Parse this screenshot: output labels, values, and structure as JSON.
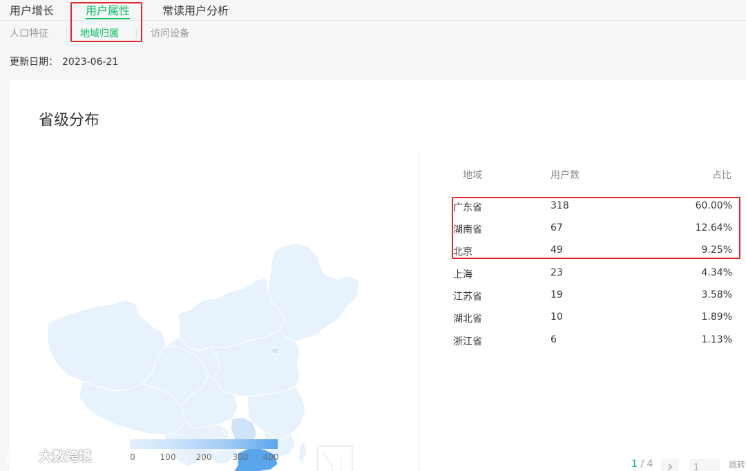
{
  "tabs": [
    {
      "label": "用户增长",
      "active": false
    },
    {
      "label": "用户属性",
      "active": true
    },
    {
      "label": "常读用户分析",
      "active": false
    }
  ],
  "sub_tabs": [
    {
      "label": "人口特征",
      "active": false
    },
    {
      "label": "地域归属",
      "active": true
    },
    {
      "label": "访问设备",
      "active": false
    }
  ],
  "update": {
    "label": "更新日期：",
    "value": "2023-06-21"
  },
  "card": {
    "title": "省级分布"
  },
  "legend": {
    "ticks": [
      "0",
      "100",
      "200",
      "300",
      "400"
    ]
  },
  "table": {
    "headers": {
      "region": "地域",
      "users": "用户数",
      "ratio": "占比"
    },
    "rows": [
      {
        "region": "广东省",
        "users": "318",
        "ratio": "60.00%"
      },
      {
        "region": "湖南省",
        "users": "67",
        "ratio": "12.64%"
      },
      {
        "region": "北京",
        "users": "49",
        "ratio": "9.25%"
      },
      {
        "region": "上海",
        "users": "23",
        "ratio": "4.34%"
      },
      {
        "region": "江苏省",
        "users": "19",
        "ratio": "3.58%"
      },
      {
        "region": "湖北省",
        "users": "10",
        "ratio": "1.89%"
      },
      {
        "region": "浙江省",
        "users": "6",
        "ratio": "1.13%"
      }
    ]
  },
  "pagination": {
    "current": "1",
    "total": "4",
    "sep": "/",
    "next_icon": "chevron-right-icon",
    "page_input": "1",
    "jump_label": "跳转"
  },
  "watermark": {
    "text": "大数跨境",
    "logo_icon": "dashu-logo-icon"
  },
  "colors": {
    "accent": "#07c160",
    "highlight": "#e02a2a",
    "map_base": "#e8f2fc",
    "map_max": "#5aa6ec"
  }
}
